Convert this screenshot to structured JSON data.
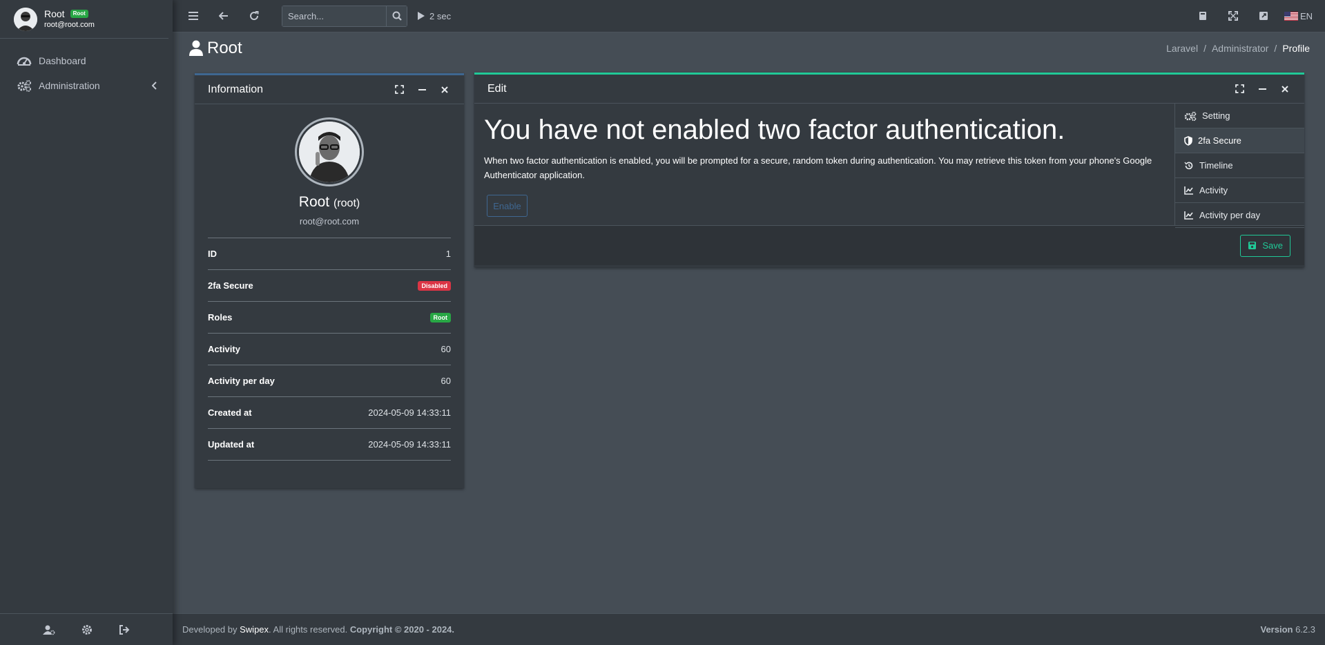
{
  "user": {
    "name": "Root",
    "badge": "Root",
    "email": "root@root.com"
  },
  "sidebar": {
    "items": [
      {
        "label": "Dashboard",
        "icon": "dashboard-icon"
      },
      {
        "label": "Administration",
        "icon": "cogs-icon"
      }
    ],
    "footer_icons": [
      "user-cog-icon",
      "gear-icon",
      "sign-out-icon"
    ]
  },
  "topbar": {
    "search_placeholder": "Search...",
    "timer": "2 sec",
    "language": "EN"
  },
  "header": {
    "title": "Root",
    "breadcrumb": [
      "Laravel",
      "Administrator",
      "Profile"
    ]
  },
  "info_card": {
    "title": "Information",
    "profile_name": "Root",
    "profile_username": "(root)",
    "profile_email": "root@root.com",
    "rows": [
      {
        "key": "ID",
        "value": "1"
      },
      {
        "key": "2fa Secure",
        "value": "Disabled"
      },
      {
        "key": "Roles",
        "value": "Root"
      },
      {
        "key": "Activity",
        "value": "60"
      },
      {
        "key": "Activity per day",
        "value": "60"
      },
      {
        "key": "Created at",
        "value": "2024-05-09 14:33:11"
      },
      {
        "key": "Updated at",
        "value": "2024-05-09 14:33:11"
      }
    ]
  },
  "edit_card": {
    "title": "Edit",
    "heading": "You have not enabled two factor authentication.",
    "description": "When two factor authentication is enabled, you will be prompted for a secure, random token during authentication. You may retrieve this token from your phone's Google Authenticator application.",
    "enable_label": "Enable",
    "save_label": "Save",
    "tabs": [
      "Setting",
      "2fa Secure",
      "Timeline",
      "Activity",
      "Activity per day"
    ],
    "active_tab": "2fa Secure"
  },
  "footer": {
    "developed_by": "Developed by",
    "company": "Swipex",
    "rights": ". All rights reserved.",
    "copyright": "Copyright © 2020 - 2024.",
    "version_label": "Version",
    "version": "6.2.3"
  },
  "colors": {
    "content_bg": "#454d55",
    "panel_bg": "#343a40",
    "accent_blue": "#3f6791",
    "accent_teal": "#20c997",
    "danger": "#dc3545",
    "success": "#28a745"
  }
}
